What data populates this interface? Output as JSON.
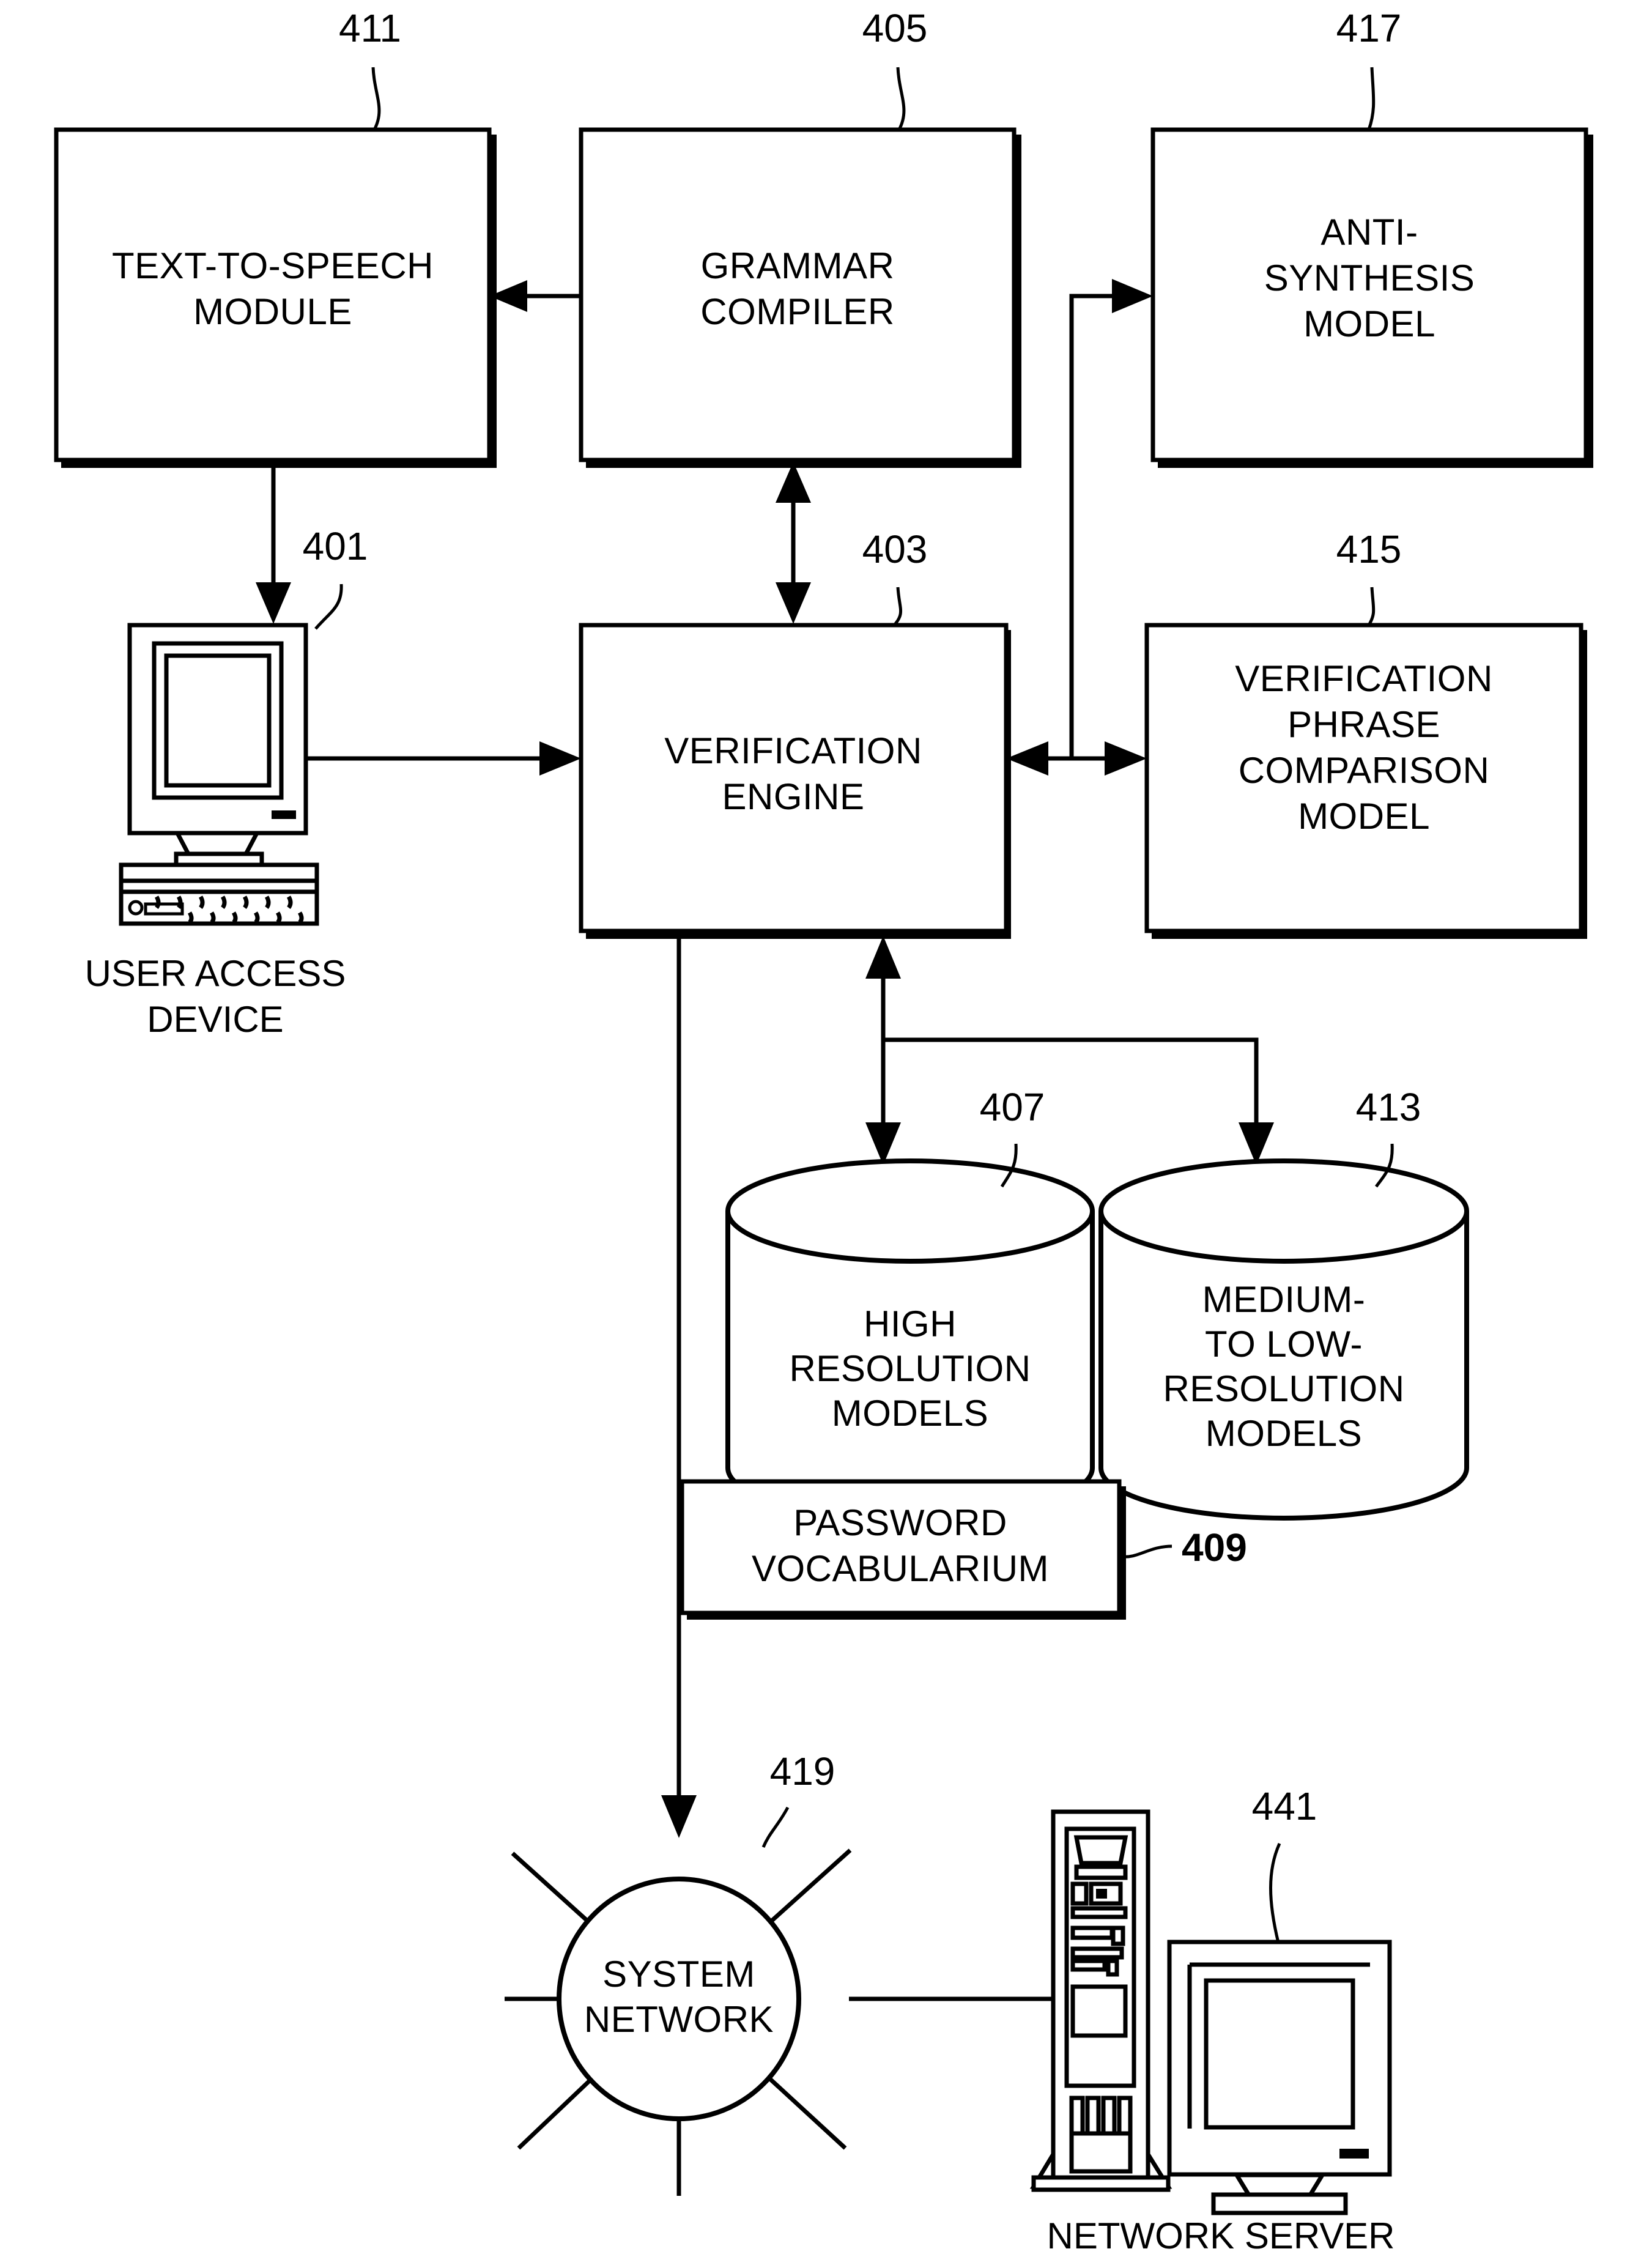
{
  "figure": {
    "type": "patent-block-diagram",
    "boxes": [
      {
        "id": "411",
        "ref": "411",
        "lines": [
          "TEXT-TO-SPEECH",
          "MODULE"
        ]
      },
      {
        "id": "405",
        "ref": "405",
        "lines": [
          "GRAMMAR",
          "COMPILER"
        ]
      },
      {
        "id": "417",
        "ref": "417",
        "lines": [
          "ANTI-",
          "SYNTHESIS",
          "MODEL"
        ]
      },
      {
        "id": "403",
        "ref": "403",
        "lines": [
          "VERIFICATION",
          "ENGINE"
        ]
      },
      {
        "id": "415",
        "ref": "415",
        "lines": [
          "VERIFICATION",
          "PHRASE",
          "COMPARISON",
          "MODEL"
        ]
      },
      {
        "id": "409",
        "ref": "409",
        "lines": [
          "PASSWORD",
          "VOCABULARIUM"
        ]
      }
    ],
    "cylinders": [
      {
        "id": "407",
        "ref": "407",
        "lines": [
          "HIGH",
          "RESOLUTION",
          "MODELS"
        ]
      },
      {
        "id": "413",
        "ref": "413",
        "lines": [
          "MEDIUM-",
          "TO LOW-",
          "RESOLUTION",
          "MODELS"
        ]
      }
    ],
    "circles": [
      {
        "id": "419",
        "ref": "419",
        "lines": [
          "SYSTEM",
          "NETWORK"
        ]
      }
    ],
    "devices": [
      {
        "id": "401",
        "ref": "401",
        "caption_lines": [
          "USER ACCESS",
          "DEVICE"
        ]
      },
      {
        "id": "441",
        "ref": "441",
        "caption_lines": [
          "NETWORK SERVER"
        ]
      }
    ],
    "colors": {
      "ink": "#000000",
      "paper": "#ffffff"
    }
  }
}
